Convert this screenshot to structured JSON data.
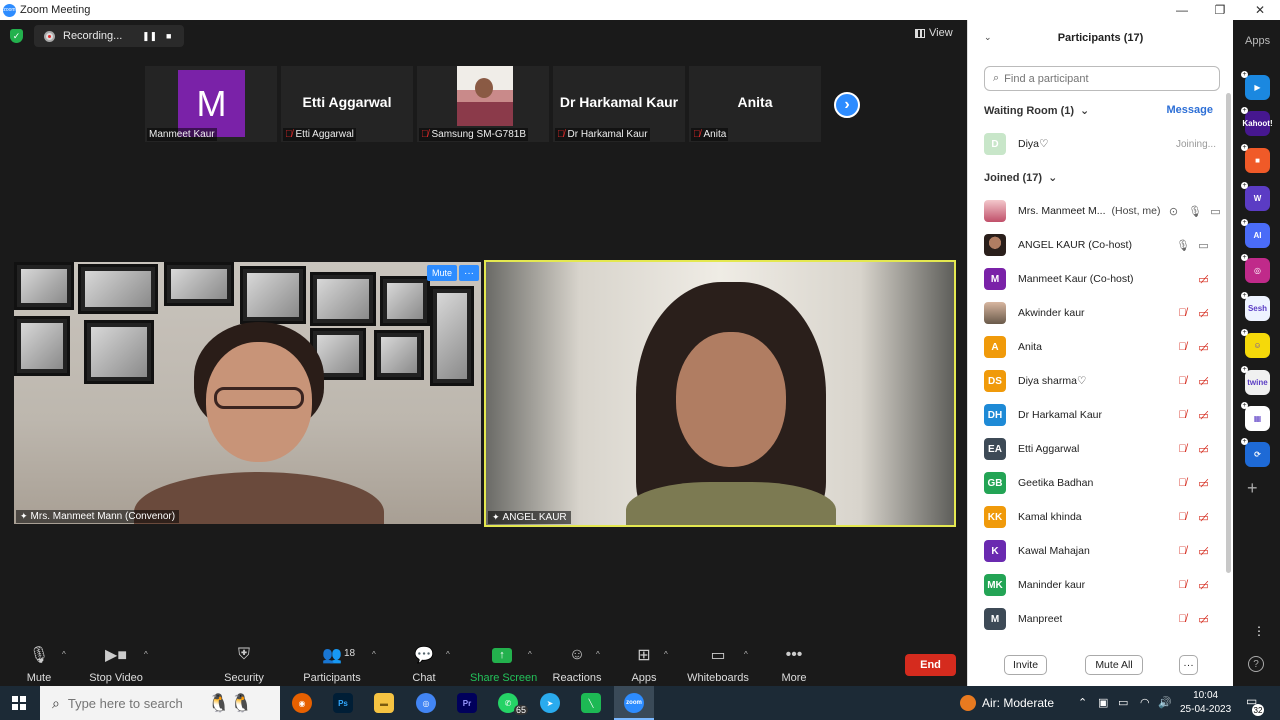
{
  "window": {
    "title": "Zoom Meeting",
    "minimize": "—",
    "maximize": "❐",
    "close": "✕"
  },
  "meeting": {
    "recording_label": "Recording...",
    "view_label": "View",
    "strip": [
      {
        "big": "M",
        "caption": "Manmeet Kaur",
        "muted": false
      },
      {
        "big": "Etti Aggarwal",
        "caption": "Etti Aggarwal",
        "muted": true
      },
      {
        "big": "",
        "caption": "Samsung SM-G781B",
        "muted": true
      },
      {
        "big": "Dr Harkamal Kaur",
        "caption": "Dr Harkamal Kaur",
        "muted": true
      },
      {
        "big": "Anita",
        "caption": "Anita",
        "muted": true
      }
    ],
    "videos": [
      {
        "caption": "Mrs. Manmeet Mann (Convenor)"
      },
      {
        "caption": "ANGEL KAUR"
      }
    ],
    "mute_hover_label": "Mute",
    "more_hover_label": "···"
  },
  "toolbar": {
    "mute": "Mute",
    "stop_video": "Stop Video",
    "security": "Security",
    "participants": "Participants",
    "participants_count": "18",
    "chat": "Chat",
    "share_screen": "Share Screen",
    "reactions": "Reactions",
    "apps": "Apps",
    "whiteboards": "Whiteboards",
    "more": "More",
    "end": "End"
  },
  "panel": {
    "title": "Participants (17)",
    "search_placeholder": "Find a participant",
    "waiting_room_label": "Waiting Room (1)",
    "message_label": "Message",
    "waiting": [
      {
        "initials": "D",
        "name": "Diya♡",
        "status": "Joining...",
        "color": "#c8e6c9"
      }
    ],
    "joined_label": "Joined (17)",
    "joined": [
      {
        "initials": "",
        "photo": "av-photo",
        "name": "Mrs. Manmeet M...",
        "role": "(Host, me)",
        "mic": "on",
        "cam": "on"
      },
      {
        "initials": "",
        "photo": "av-photo2",
        "name": "ANGEL KAUR (Co-host)",
        "mic": "on",
        "cam": "on"
      },
      {
        "initials": "M",
        "name": "Manmeet Kaur (Co-host)",
        "color": "#7a22a8",
        "mic": "none",
        "cam": "off"
      },
      {
        "initials": "",
        "photo": "av-photo3",
        "name": "Akwinder kaur",
        "mic": "off",
        "cam": "off"
      },
      {
        "initials": "A",
        "name": "Anita",
        "color": "#f09a0a",
        "mic": "off",
        "cam": "off"
      },
      {
        "initials": "DS",
        "name": "Diya sharma♡",
        "color": "#f09a0a",
        "mic": "off",
        "cam": "off"
      },
      {
        "initials": "DH",
        "name": "Dr Harkamal Kaur",
        "color": "#1e8ad6",
        "mic": "off",
        "cam": "off"
      },
      {
        "initials": "EA",
        "name": "Etti Aggarwal",
        "color": "#3d4a56",
        "mic": "off",
        "cam": "off"
      },
      {
        "initials": "GB",
        "name": "Geetika Badhan",
        "color": "#23a455",
        "mic": "off",
        "cam": "off"
      },
      {
        "initials": "KK",
        "name": "Kamal khinda",
        "color": "#f09a0a",
        "mic": "off",
        "cam": "off"
      },
      {
        "initials": "K",
        "name": "Kawal Mahajan",
        "color": "#6a2ab0",
        "mic": "off",
        "cam": "off"
      },
      {
        "initials": "MK",
        "name": "Maninder kaur",
        "color": "#23a455",
        "mic": "off",
        "cam": "off"
      },
      {
        "initials": "M",
        "name": "Manpreet",
        "color": "#3d4a56",
        "mic": "off",
        "cam": "off"
      }
    ],
    "invite": "Invite",
    "mute_all": "Mute All",
    "more": "···"
  },
  "apps_column": {
    "label": "Apps",
    "items": [
      {
        "name": "app-1",
        "text": "▶",
        "color": "#1b88e0"
      },
      {
        "name": "kahoot",
        "text": "Kahoot!",
        "color": "#46178f"
      },
      {
        "name": "app-3",
        "text": "■",
        "color": "#f05a28"
      },
      {
        "name": "wooclap",
        "text": "W",
        "color": "#5b3cc4"
      },
      {
        "name": "app-5",
        "text": "AI",
        "color": "#4a6cf7"
      },
      {
        "name": "app-6",
        "text": "◎",
        "color": "#c02a8a"
      },
      {
        "name": "sesh",
        "text": "Sesh",
        "color": "#eef3ff"
      },
      {
        "name": "app-8",
        "text": "☺",
        "color": "#f5d90a"
      },
      {
        "name": "twine",
        "text": "twine",
        "color": "#f0f0f0"
      },
      {
        "name": "app-10",
        "text": "▦",
        "color": "#ffffff"
      },
      {
        "name": "app-11",
        "text": "⟳",
        "color": "#1e6ad6"
      }
    ]
  },
  "taskbar": {
    "search_placeholder": "Type here to search",
    "whatsapp_badge": "65",
    "weather": "Air: Moderate",
    "time": "10:04",
    "date": "25-04-2023",
    "notifications": "32"
  }
}
